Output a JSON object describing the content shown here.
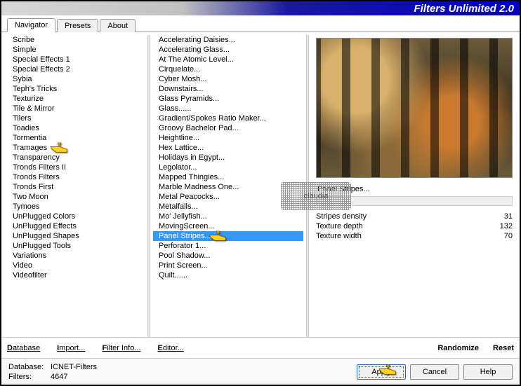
{
  "app": {
    "title": "Filters Unlimited 2.0"
  },
  "tabs": [
    {
      "label": "Navigator",
      "active": true
    },
    {
      "label": "Presets",
      "active": false
    },
    {
      "label": "About",
      "active": false
    }
  ],
  "list1": {
    "items": [
      "Scribe",
      "Simple",
      "Special Effects 1",
      "Special Effects 2",
      "Sybia",
      "Teph's Tricks",
      "Texturize",
      "Tile & Mirror",
      "Tilers",
      "Toadies",
      "Tormentia",
      "Tramages",
      "Transparency",
      "Tronds Filters II",
      "Tronds Filters",
      "Tronds First",
      "Two Moon",
      "Tymoes",
      "UnPlugged Colors",
      "UnPlugged Effects",
      "UnPlugged Shapes",
      "UnPlugged Tools",
      "Variations",
      "Video",
      "Videofilter"
    ],
    "pointer_index": 11
  },
  "list2": {
    "items": [
      "Accelerating Daisies...",
      "Accelerating Glass...",
      "At The Atomic Level...",
      "Cirquelate...",
      "Cyber Mosh...",
      "Downstairs...",
      "Glass Pyramids...",
      "Glass......",
      "Gradient/Spokes Ratio Maker...",
      "Groovy Bachelor Pad...",
      "Heightline...",
      "Hex Lattice...",
      "Holidays in Egypt...",
      "Legolator...",
      "Mapped Thingies...",
      "Marble Madness One...",
      "Metal Peacocks...",
      "Metalfalls...",
      "Mo' Jellyfish...",
      "MovingScreen...",
      "Panel Stripes...",
      "Perforator 1...",
      "Pool Shadow...",
      "Print Screen...",
      "Quilt......"
    ],
    "selected_index": 20,
    "pointer_index": 20
  },
  "preview": {
    "title": "Panel Stripes..."
  },
  "params": [
    {
      "label": "Stripes density",
      "value": "31"
    },
    {
      "label": "Texture depth",
      "value": "132"
    },
    {
      "label": "Texture width",
      "value": "70"
    }
  ],
  "toolbar": {
    "database": "Database",
    "import": "Import...",
    "filterinfo": "Filter Info...",
    "editor": "Editor...",
    "randomize": "Randomize",
    "reset": "Reset"
  },
  "footer": {
    "db_label": "Database:",
    "db_value": "ICNET-Filters",
    "filters_label": "Filters:",
    "filters_value": "4647",
    "apply": "Apply",
    "cancel": "Cancel",
    "help": "Help"
  },
  "watermark": "claudia"
}
